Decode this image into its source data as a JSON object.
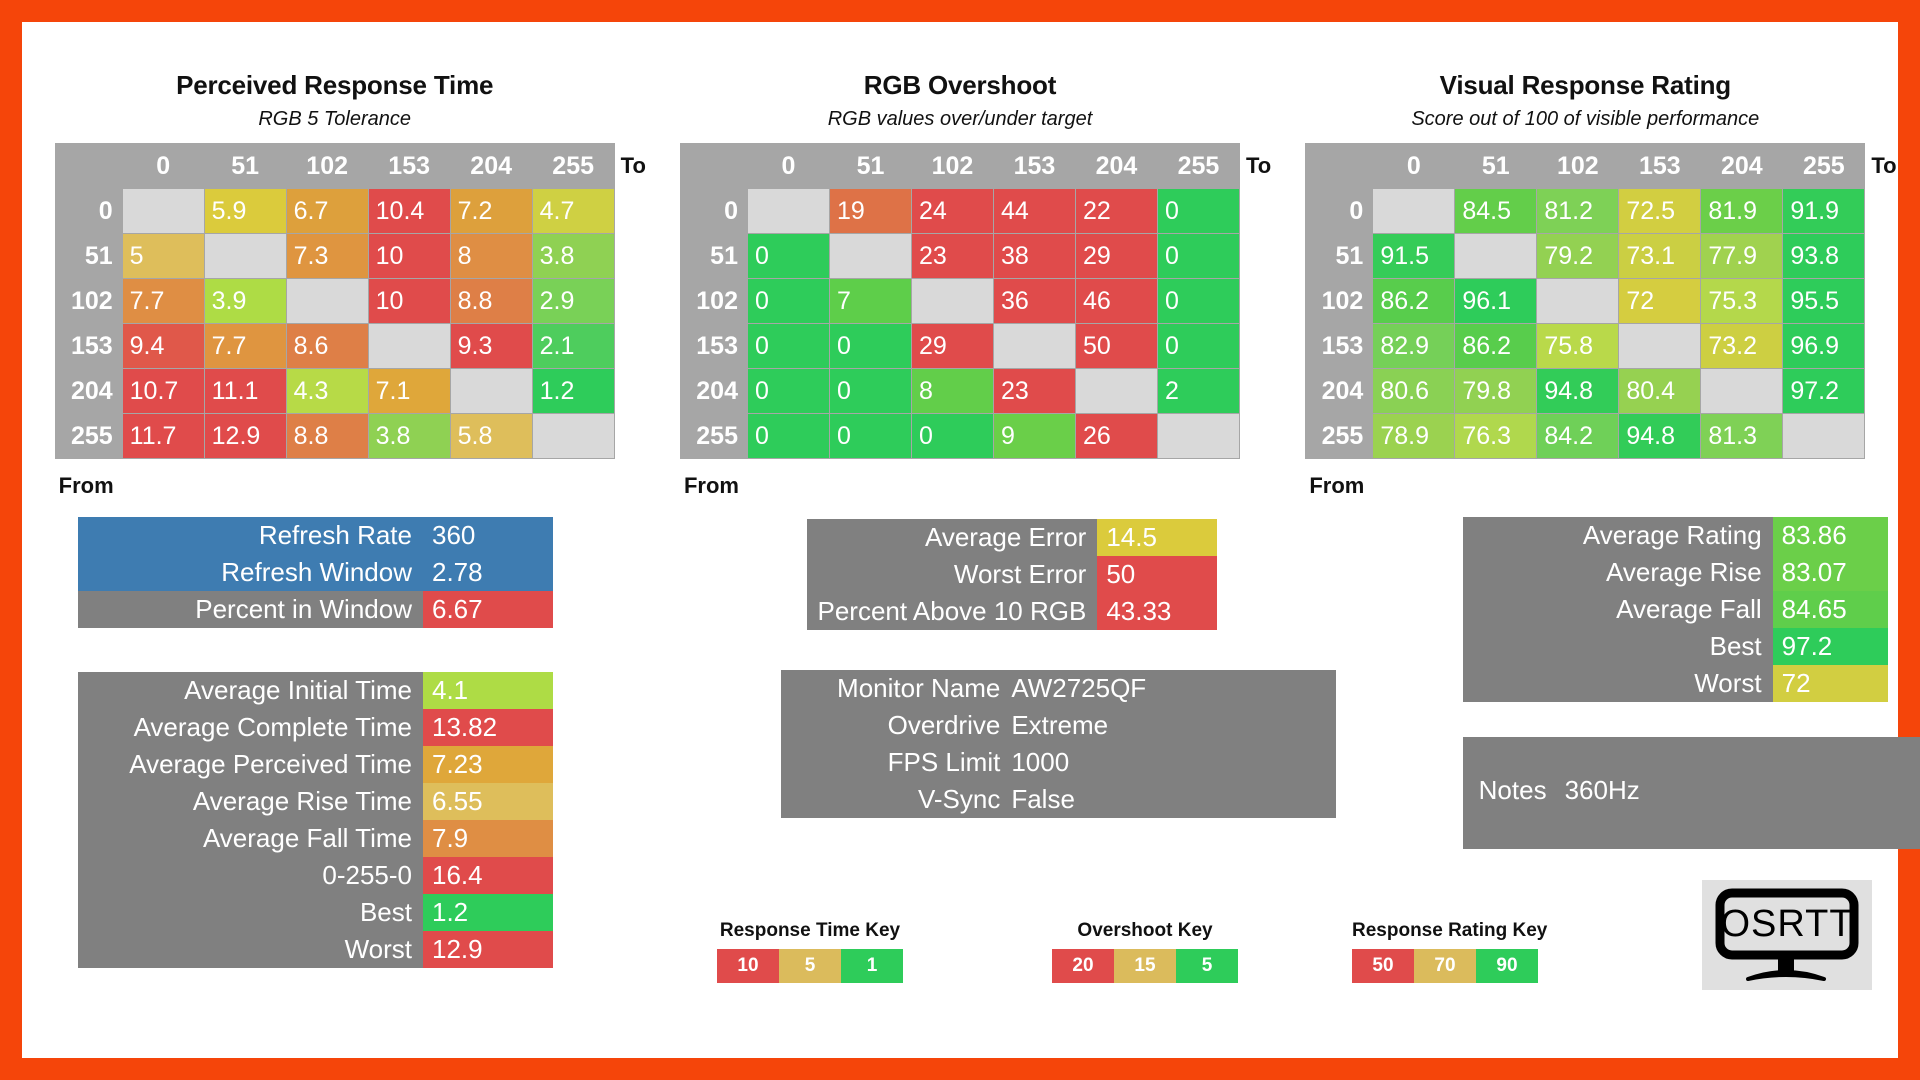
{
  "accent": {
    "page_border": "#F5450A",
    "header_grey": "#A6A6A6",
    "diag_grey": "#D9D9D9",
    "block_grey": "#808080",
    "blue": "#3E7CB1",
    "red": "#E04B4B",
    "amber": "#DDA03C",
    "yellow": "#DBCB3C",
    "lightgreen": "#AEDC45",
    "green": "#2ECC5A"
  },
  "tables": [
    {
      "title": "Perceived Response Time",
      "subtitle": "RGB 5 Tolerance",
      "axis_to": "To",
      "axis_from": "From",
      "columns": [
        "0",
        "51",
        "102",
        "153",
        "204",
        "255"
      ],
      "rows": [
        "0",
        "51",
        "102",
        "153",
        "204",
        "255"
      ],
      "cells": [
        [
          "",
          "5.9",
          "6.7",
          "10.4",
          "7.2",
          "4.7"
        ],
        [
          "5",
          "",
          "7.3",
          "10",
          "8",
          "3.8"
        ],
        [
          "7.7",
          "3.9",
          "",
          "10",
          "8.8",
          "2.9"
        ],
        [
          "9.4",
          "7.7",
          "8.6",
          "",
          "9.3",
          "2.1"
        ],
        [
          "10.7",
          "11.1",
          "4.3",
          "7.1",
          "",
          "1.2"
        ],
        [
          "11.7",
          "12.9",
          "8.8",
          "3.8",
          "5.8",
          ""
        ]
      ],
      "colors": [
        [
          "",
          "#DBCB3C",
          "#DDA03C",
          "#E04B4B",
          "#DDA03C",
          "#CFD043"
        ],
        [
          "#DEBE5B",
          "",
          "#DF9540",
          "#E04B4B",
          "#DF8E44",
          "#8FD153"
        ],
        [
          "#DF8E44",
          "#AEDC45",
          "",
          "#E04B4B",
          "#DE7F47",
          "#79D157"
        ],
        [
          "#E0584A",
          "#DF9540",
          "#DE7F47",
          "",
          "#E04B4B",
          "#4ECD5D"
        ],
        [
          "#E04B4B",
          "#E04B4B",
          "#B7DA47",
          "#DFA73A",
          "",
          "#2ECC5A"
        ],
        [
          "#E04B4B",
          "#E04B4B",
          "#DE7F47",
          "#8FD153",
          "#DEBE5B",
          ""
        ]
      ]
    },
    {
      "title": "RGB Overshoot",
      "subtitle": "RGB values over/under target",
      "axis_to": "To",
      "axis_from": "From",
      "columns": [
        "0",
        "51",
        "102",
        "153",
        "204",
        "255"
      ],
      "rows": [
        "0",
        "51",
        "102",
        "153",
        "204",
        "255"
      ],
      "cells": [
        [
          "",
          "19",
          "24",
          "44",
          "22",
          "0"
        ],
        [
          "0",
          "",
          "23",
          "38",
          "29",
          "0"
        ],
        [
          "0",
          "7",
          "",
          "36",
          "46",
          "0"
        ],
        [
          "0",
          "0",
          "29",
          "",
          "50",
          "0"
        ],
        [
          "0",
          "0",
          "8",
          "23",
          "",
          "2"
        ],
        [
          "0",
          "0",
          "0",
          "9",
          "26",
          ""
        ]
      ],
      "colors": [
        [
          "",
          "#DE7247",
          "#E04B4B",
          "#E04B4B",
          "#E04B4B",
          "#2ECC5A"
        ],
        [
          "#2ECC5A",
          "",
          "#E04B4B",
          "#E04B4B",
          "#E04B4B",
          "#2ECC5A"
        ],
        [
          "#2ECC5A",
          "#5ECE4A",
          "",
          "#E04B4B",
          "#E04B4B",
          "#2ECC5A"
        ],
        [
          "#2ECC5A",
          "#2ECC5A",
          "#E04B4B",
          "",
          "#E04B4B",
          "#2ECC5A"
        ],
        [
          "#2ECC5A",
          "#2ECC5A",
          "#62CE4A",
          "#E04B4B",
          "",
          "#2ECC5A"
        ],
        [
          "#2ECC5A",
          "#2ECC5A",
          "#2ECC5A",
          "#6ACF49",
          "#E04B4B",
          ""
        ]
      ]
    },
    {
      "title": "Visual Response Rating",
      "subtitle": "Score out of 100 of visible performance",
      "axis_to": "To",
      "axis_from": "From",
      "columns": [
        "0",
        "51",
        "102",
        "153",
        "204",
        "255"
      ],
      "rows": [
        "0",
        "51",
        "102",
        "153",
        "204",
        "255"
      ],
      "cells": [
        [
          "",
          "84.5",
          "81.2",
          "72.5",
          "81.9",
          "91.9"
        ],
        [
          "91.5",
          "",
          "79.2",
          "73.1",
          "77.9",
          "93.8"
        ],
        [
          "86.2",
          "96.1",
          "",
          "72",
          "75.3",
          "95.5"
        ],
        [
          "82.9",
          "86.2",
          "75.8",
          "",
          "73.2",
          "96.9"
        ],
        [
          "80.6",
          "79.8",
          "94.8",
          "80.4",
          "",
          "97.2"
        ],
        [
          "78.9",
          "76.3",
          "84.2",
          "94.8",
          "81.3",
          ""
        ]
      ],
      "colors": [
        [
          "",
          "#63CE4A",
          "#7ED156",
          "#D2CE41",
          "#6BCF49",
          "#33CC58"
        ],
        [
          "#35CC58",
          "",
          "#93D152",
          "#CBCF43",
          "#A0D24F",
          "#2ECC5A"
        ],
        [
          "#58CD4C",
          "#2ECC5A",
          "",
          "#D5CD40",
          "#B4D84B",
          "#2ECC5A"
        ],
        [
          "#75D058",
          "#58CD4C",
          "#B9D94A",
          "",
          "#CDCF42",
          "#2ECC5A"
        ],
        [
          "#8AD154",
          "#91D152",
          "#32CC58",
          "#96D151",
          "",
          "#2ECC5A"
        ],
        [
          "#9BD250",
          "#B0D84D",
          "#6FD058",
          "#32CC58",
          "#7FD156",
          ""
        ]
      ]
    }
  ],
  "summary_left_top": {
    "rows": [
      {
        "label": "Refresh Rate",
        "value": "360",
        "label_color": "#3E7CB1",
        "value_color": "#3E7CB1"
      },
      {
        "label": "Refresh Window",
        "value": "2.78",
        "label_color": "#3E7CB1",
        "value_color": "#3E7CB1"
      },
      {
        "label": "Percent in Window",
        "value": "6.67",
        "label_color": "#808080",
        "value_color": "#E04B4B"
      }
    ]
  },
  "summary_left_bottom": {
    "rows": [
      {
        "label": "Average Initial Time",
        "value": "4.1",
        "value_color": "#AEDC45"
      },
      {
        "label": "Average Complete Time",
        "value": "13.82",
        "value_color": "#E04B4B"
      },
      {
        "label": "Average Perceived Time",
        "value": "7.23",
        "value_color": "#DFA73A"
      },
      {
        "label": "Average Rise Time",
        "value": "6.55",
        "value_color": "#DEBE5B"
      },
      {
        "label": "Average Fall Time",
        "value": "7.9",
        "value_color": "#DF8E44"
      },
      {
        "label": "0-255-0",
        "value": "16.4",
        "value_color": "#E04B4B"
      },
      {
        "label": "Best",
        "value": "1.2",
        "value_color": "#2ECC5A"
      },
      {
        "label": "Worst",
        "value": "12.9",
        "value_color": "#E04B4B"
      }
    ]
  },
  "summary_mid_top": {
    "rows": [
      {
        "label": "Average Error",
        "value": "14.5",
        "value_color": "#DBCB3C"
      },
      {
        "label": "Worst Error",
        "value": "50",
        "value_color": "#E04B4B"
      },
      {
        "label": "Percent Above 10 RGB",
        "value": "43.33",
        "value_color": "#E04B4B"
      }
    ]
  },
  "monitor_info": {
    "rows": [
      {
        "label": "Monitor Name",
        "value": "AW2725QF"
      },
      {
        "label": "Overdrive",
        "value": "Extreme"
      },
      {
        "label": "FPS Limit",
        "value": "1000"
      },
      {
        "label": "V-Sync",
        "value": "False"
      }
    ]
  },
  "summary_right_top": {
    "rows": [
      {
        "label": "Average Rating",
        "value": "83.86",
        "value_color": "#6BCF49"
      },
      {
        "label": "Average Rise",
        "value": "83.07",
        "value_color": "#6BCF49"
      },
      {
        "label": "Average Fall",
        "value": "84.65",
        "value_color": "#5FCE4B"
      },
      {
        "label": "Best",
        "value": "97.2",
        "value_color": "#2ECC5A"
      },
      {
        "label": "Worst",
        "value": "72",
        "value_color": "#D2CE41"
      }
    ]
  },
  "notes": {
    "label": "Notes",
    "value": "360Hz"
  },
  "keys": [
    {
      "title": "Response Time Key",
      "cells": [
        {
          "label": "10",
          "color": "#E04B4B"
        },
        {
          "label": "5",
          "color": "#DBBB5C"
        },
        {
          "label": "1",
          "color": "#2ECC5A"
        }
      ]
    },
    {
      "title": "Overshoot Key",
      "cells": [
        {
          "label": "20",
          "color": "#E04B4B"
        },
        {
          "label": "15",
          "color": "#DBBB5C"
        },
        {
          "label": "5",
          "color": "#2ECC5A"
        }
      ]
    },
    {
      "title": "Response Rating Key",
      "cells": [
        {
          "label": "50",
          "color": "#E04B4B"
        },
        {
          "label": "70",
          "color": "#DBBB5C"
        },
        {
          "label": "90",
          "color": "#2ECC5A"
        }
      ]
    }
  ],
  "logo": {
    "text": "OSRTT"
  }
}
